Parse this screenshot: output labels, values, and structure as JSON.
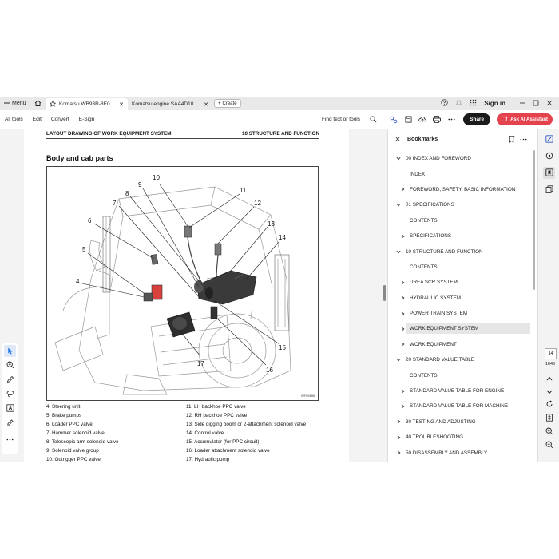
{
  "tabbar": {
    "menu_label": "Menu",
    "tabs": [
      {
        "title": "Komatsu WB93R-8E0 se...",
        "active": true
      },
      {
        "title": "Komatsu engine SAA4D102SE-I...",
        "active": false
      }
    ],
    "create_label": "Create",
    "signin_label": "Sign in"
  },
  "toolbar": {
    "menu": [
      "All tools",
      "Edit",
      "Convert",
      "E-Sign"
    ],
    "find_text": "Find text or tools",
    "share_label": "Share",
    "ai_label": "Ask AI Assistant"
  },
  "document": {
    "header_left": "LAYOUT DRAWING OF WORK EQUIPMENT SYSTEM",
    "header_right": "10 STRUCTURE AND FUNCTION",
    "section_title": "Body and cab parts",
    "figure_code": "9EF009386",
    "callouts": [
      "10",
      "9",
      "11",
      "8",
      "7",
      "12",
      "6",
      "13",
      "14",
      "5",
      "4",
      "15",
      "16",
      "17"
    ],
    "parts_left": [
      "4: Steering unit",
      "5: Brake pumps",
      "6: Loader PPC valve",
      "7: Hammer solenoid valve",
      "8: Telescopic arm solenoid valve",
      "9: Solenoid valve group",
      "10: Outrigger PPC valve"
    ],
    "parts_right": [
      "11: LH backhoe PPC valve",
      "12: RH backhoe PPC valve",
      "13: Side digging boom or 2-attachment solenoid valve",
      "14: Control valve",
      "15: Accumulator (for PPC circuit)",
      "16: Loader attachment solenoid valve",
      "17: Hydraulic pump"
    ]
  },
  "bookmarks": {
    "title": "Bookmarks",
    "items": [
      {
        "label": "00 INDEX AND FOREWORD",
        "level": 0,
        "state": "expanded"
      },
      {
        "label": "INDEX",
        "level": 1,
        "state": "leaf"
      },
      {
        "label": "FOREWORD, SAFETY, BASIC INFORMATION",
        "level": 1,
        "state": "collapsed"
      },
      {
        "label": "01 SPECIFICATIONS",
        "level": 0,
        "state": "expanded"
      },
      {
        "label": "CONTENTS",
        "level": 1,
        "state": "leaf"
      },
      {
        "label": "SPECIFICATIONS",
        "level": 1,
        "state": "collapsed"
      },
      {
        "label": "10 STRUCTURE AND FUNCTION",
        "level": 0,
        "state": "expanded"
      },
      {
        "label": "CONTENTS",
        "level": 1,
        "state": "leaf"
      },
      {
        "label": "UREA SCR SYSTEM",
        "level": 1,
        "state": "collapsed"
      },
      {
        "label": "HYDRAULIC SYSTEM",
        "level": 1,
        "state": "collapsed"
      },
      {
        "label": "POWER TRAIN SYSTEM",
        "level": 1,
        "state": "collapsed"
      },
      {
        "label": "WORK EQUIPMENT SYSTEM",
        "level": 1,
        "state": "collapsed",
        "selected": true
      },
      {
        "label": "WORK EQUIPMENT",
        "level": 1,
        "state": "collapsed"
      },
      {
        "label": "20 STANDARD VALUE TABLE",
        "level": 0,
        "state": "expanded"
      },
      {
        "label": "CONTENTS",
        "level": 1,
        "state": "leaf"
      },
      {
        "label": "STANDARD VALUE TABLE FOR ENGINE",
        "level": 1,
        "state": "collapsed"
      },
      {
        "label": "STANDARD VALUE TABLE FOR MACHINE",
        "level": 1,
        "state": "collapsed"
      },
      {
        "label": "30 TESTING AND ADJUSTING",
        "level": 0,
        "state": "collapsed"
      },
      {
        "label": "40 TROUBLESHOOTING",
        "level": 0,
        "state": "collapsed"
      },
      {
        "label": "50 DISASSEMBLY AND ASSEMBLY",
        "level": 0,
        "state": "collapsed"
      }
    ]
  },
  "pagenav": {
    "current_page": "14",
    "total_pages": "1646"
  },
  "colors": {
    "accent_red": "#e4424d",
    "share_bg": "#1b1b1b",
    "selected_tool": "#1a73e8",
    "highlight_red": "#d9423c"
  }
}
